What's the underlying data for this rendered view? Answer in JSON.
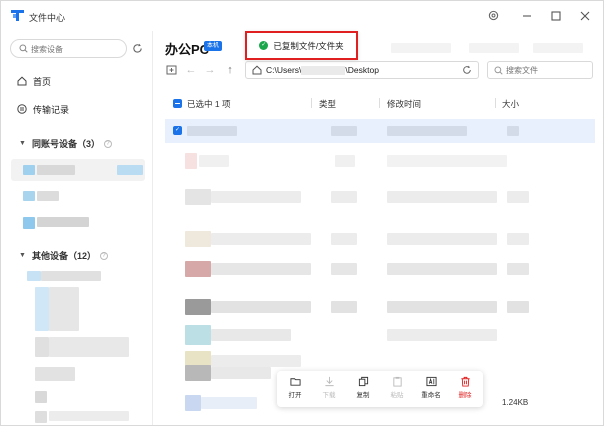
{
  "window": {
    "title": "文件中心",
    "controls": [
      "settings-icon",
      "minimize-icon",
      "maximize-icon",
      "close-icon"
    ]
  },
  "sidebar": {
    "search_placeholder": "搜索设备",
    "nav": [
      {
        "label": "首页",
        "icon": "home-icon"
      },
      {
        "label": "传输记录",
        "icon": "transfer-icon"
      }
    ],
    "groups": [
      {
        "label": "同账号设备（3）"
      },
      {
        "label": "其他设备（12）"
      }
    ]
  },
  "main": {
    "device_title": "办公PC",
    "device_badge": "本机",
    "toast": "已复制文件/文件夹",
    "path": {
      "prefix": "C:\\Users\\",
      "suffix": "\\Desktop"
    },
    "search_placeholder": "搜索文件",
    "columns": {
      "selected": "已选中 1 项",
      "type": "类型",
      "modified": "修改时间",
      "size": "大小"
    },
    "visible_size": "1.24KB",
    "actions": [
      {
        "label": "打开",
        "icon": "open-icon",
        "state": "enabled"
      },
      {
        "label": "下载",
        "icon": "download-icon",
        "state": "disabled"
      },
      {
        "label": "复制",
        "icon": "copy-icon",
        "state": "enabled"
      },
      {
        "label": "粘贴",
        "icon": "paste-icon",
        "state": "disabled"
      },
      {
        "label": "重命名",
        "icon": "rename-icon",
        "state": "enabled"
      },
      {
        "label": "删除",
        "icon": "delete-icon",
        "state": "danger"
      }
    ]
  },
  "colors": {
    "accent": "#1a73e8",
    "danger": "#e02020",
    "success": "#1aa64b",
    "selected_row": "#e8f0fe"
  }
}
